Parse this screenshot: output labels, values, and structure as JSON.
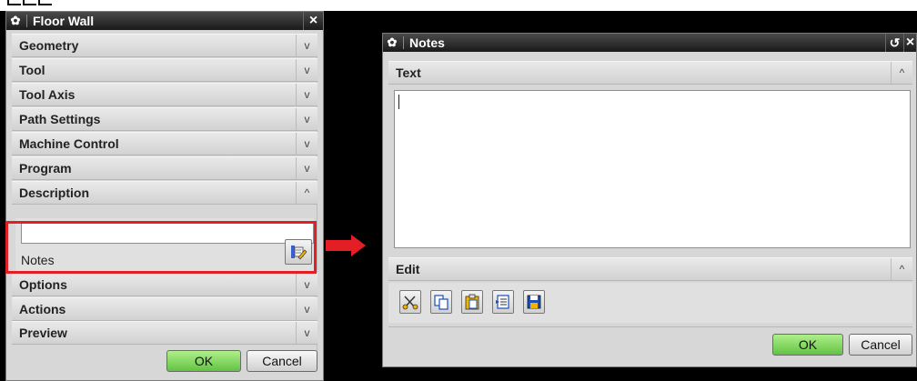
{
  "floor_wall": {
    "title": "Floor Wall",
    "close": "×",
    "sections": [
      {
        "label": "Geometry",
        "state": "v"
      },
      {
        "label": "Tool",
        "state": "v"
      },
      {
        "label": "Tool Axis",
        "state": "v"
      },
      {
        "label": "Path Settings",
        "state": "v"
      },
      {
        "label": "Machine Control",
        "state": "v"
      },
      {
        "label": "Program",
        "state": "v"
      },
      {
        "label": "Description",
        "state": "^"
      }
    ],
    "description_value": "",
    "notes_label": "Notes",
    "sections_after": [
      {
        "label": "Options",
        "state": "v"
      },
      {
        "label": "Actions",
        "state": "v"
      },
      {
        "label": "Preview",
        "state": "v"
      }
    ],
    "ok": "OK",
    "cancel": "Cancel"
  },
  "notes_dialog": {
    "title": "Notes",
    "reset": "↺",
    "close": "×",
    "text_section": {
      "label": "Text",
      "state": "^"
    },
    "text_value": "",
    "edit_section": {
      "label": "Edit",
      "state": "^"
    },
    "edit_tools": [
      "cut-icon",
      "copy-icon",
      "paste-icon",
      "insert-text-icon",
      "save-icon"
    ],
    "ok": "OK",
    "cancel": "Cancel"
  },
  "colors": {
    "highlight": "#e31e24",
    "ok_button": "#63c243",
    "title_bar": "#1a1a1a"
  }
}
